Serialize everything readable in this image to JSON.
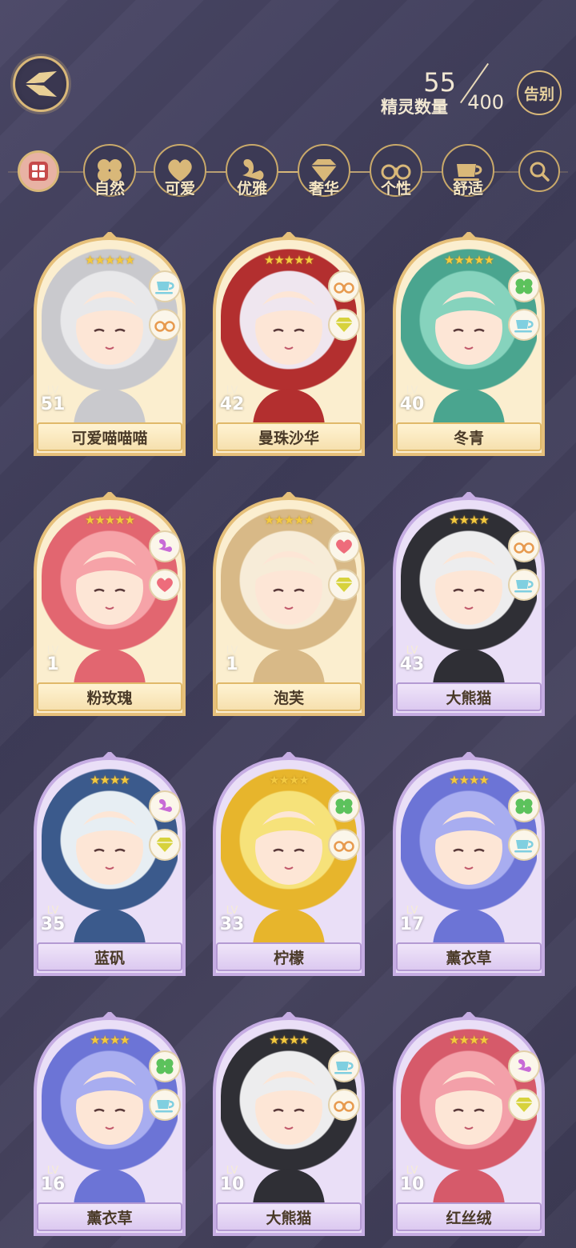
{
  "header": {
    "count_label": "精灵数量",
    "count_current": "55",
    "count_max": "400",
    "farewell_label": "告别"
  },
  "filters": [
    {
      "id": "all",
      "label": ""
    },
    {
      "id": "nature",
      "label": "自然"
    },
    {
      "id": "cute",
      "label": "可爱"
    },
    {
      "id": "elegant",
      "label": "优雅"
    },
    {
      "id": "luxury",
      "label": "奢华"
    },
    {
      "id": "personality",
      "label": "个性"
    },
    {
      "id": "comfort",
      "label": "舒适"
    },
    {
      "id": "search",
      "label": ""
    }
  ],
  "cards": [
    {
      "name": "可爱喵喵喵",
      "lv": "51",
      "stars": "★★★★★",
      "frame": "gold",
      "tags": [
        "cup",
        "glasses"
      ],
      "palette": [
        "#e8e8ea",
        "#c9c9cd"
      ]
    },
    {
      "name": "曼珠沙华",
      "lv": "42",
      "stars": "★★★★★",
      "frame": "gold",
      "tags": [
        "glasses",
        "diamond"
      ],
      "palette": [
        "#efe6ef",
        "#b32f2f"
      ]
    },
    {
      "name": "冬青",
      "lv": "40",
      "stars": "★★★★★",
      "frame": "gold",
      "tags": [
        "clover",
        "cup"
      ],
      "palette": [
        "#86d3bd",
        "#4aa58f"
      ]
    },
    {
      "name": "粉玫瑰",
      "lv": "1",
      "stars": "★★★★★",
      "frame": "gold",
      "tags": [
        "swan",
        "heart"
      ],
      "palette": [
        "#f6a3a8",
        "#e26670"
      ]
    },
    {
      "name": "泡芙",
      "lv": "1",
      "stars": "★★★★★",
      "frame": "gold",
      "tags": [
        "heart",
        "diamond"
      ],
      "palette": [
        "#f7ecd8",
        "#d8b987"
      ]
    },
    {
      "name": "大熊猫",
      "lv": "43",
      "stars": "★★★★",
      "frame": "purple",
      "tags": [
        "glasses",
        "cup"
      ],
      "palette": [
        "#ededee",
        "#2f2f35"
      ]
    },
    {
      "name": "蓝矾",
      "lv": "35",
      "stars": "★★★★",
      "frame": "purple",
      "tags": [
        "swan",
        "diamond"
      ],
      "palette": [
        "#e7eef3",
        "#3b5a8c"
      ]
    },
    {
      "name": "柠檬",
      "lv": "33",
      "stars": "★★★★",
      "frame": "purple",
      "tags": [
        "clover",
        "glasses"
      ],
      "palette": [
        "#f6e27a",
        "#e7b52c"
      ]
    },
    {
      "name": "薰衣草",
      "lv": "17",
      "stars": "★★★★",
      "frame": "purple",
      "tags": [
        "clover",
        "cup"
      ],
      "palette": [
        "#a8adf0",
        "#6c74d6"
      ]
    },
    {
      "name": "薰衣草",
      "lv": "16",
      "stars": "★★★★",
      "frame": "purple",
      "tags": [
        "clover",
        "cup"
      ],
      "palette": [
        "#a8adf0",
        "#6c74d6"
      ]
    },
    {
      "name": "大熊猫",
      "lv": "10",
      "stars": "★★★★",
      "frame": "purple",
      "tags": [
        "cup",
        "glasses"
      ],
      "palette": [
        "#ededee",
        "#2f2f35"
      ]
    },
    {
      "name": "红丝绒",
      "lv": "10",
      "stars": "★★★★",
      "frame": "purple",
      "tags": [
        "swan",
        "diamond"
      ],
      "palette": [
        "#f3a0a9",
        "#d65a6a"
      ]
    }
  ],
  "lv_label": "LV",
  "colors": {
    "gold": "#e0b96a",
    "purple": "#b49ad3",
    "accent": "#d9b879"
  }
}
